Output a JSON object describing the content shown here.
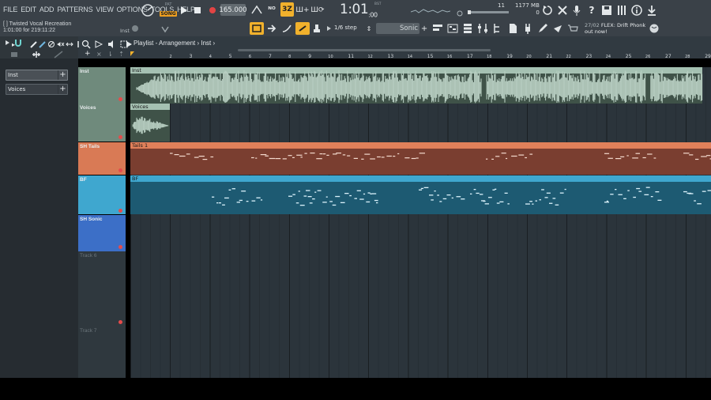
{
  "menu": {
    "items": [
      "FILE",
      "EDIT",
      "ADD",
      "PATTERNS",
      "VIEW",
      "OPTIONS",
      "TOOLS",
      "HELP"
    ]
  },
  "transport": {
    "pat_label": "PAT",
    "song_label": "SONG",
    "tempo": "165.000",
    "time_main": "1:01",
    "time_sub": ":00",
    "time_mode": "B:S:T",
    "loop_mode": "3Z"
  },
  "monitor": {
    "voices": "11",
    "cpu": "0",
    "memory": "1177 MB"
  },
  "hint_bar": {
    "title": "[   ] Twisted Vocal Recreation",
    "position": "1:01:00 for 219:11:22",
    "channel": "Inst"
  },
  "snap": {
    "step": "1/6 step",
    "pattern": "Sonic"
  },
  "news": {
    "date": "27/02",
    "headline": "FLEX: Drift Phonk",
    "subline": "out now!"
  },
  "picker": {
    "items": [
      {
        "label": "Inst"
      },
      {
        "label": "Voices"
      }
    ]
  },
  "playlist": {
    "title": "Playlist - Arrangement",
    "current": "Inst",
    "bars": [
      "2",
      "3",
      "4",
      "5",
      "6",
      "7",
      "8",
      "9",
      "10",
      "11",
      "12",
      "13",
      "14",
      "15",
      "16",
      "17",
      "18",
      "19",
      "20",
      "21",
      "22",
      "23",
      "24",
      "25",
      "26",
      "27",
      "28",
      "29"
    ]
  },
  "tracks": [
    {
      "name": "Inst",
      "color": "#6f8a7c",
      "clip": "Inst",
      "clip_color": "#b8cfc2"
    },
    {
      "name": "Voices",
      "color": "#6f8a7c",
      "clip": "Voices",
      "clip_color": "#b8cfc2"
    },
    {
      "name": "SH Tails",
      "color": "#d97a55",
      "clip": "Tails 1",
      "clip_color": "#e0805a"
    },
    {
      "name": "BF",
      "color": "#3fa7cf",
      "clip": "BF",
      "clip_color": "#3fa7cf"
    },
    {
      "name": "SH Sonic",
      "color": "#3c6fc7",
      "clip": "",
      "clip_color": ""
    },
    {
      "name": "Track 6",
      "color": "",
      "clip": "",
      "clip_color": ""
    },
    {
      "name": "Track 7",
      "color": "",
      "clip": "",
      "clip_color": ""
    }
  ],
  "colors": {
    "accent": "#f1b12c",
    "toolbar": "#3a4148",
    "grid": "#2b343b"
  }
}
